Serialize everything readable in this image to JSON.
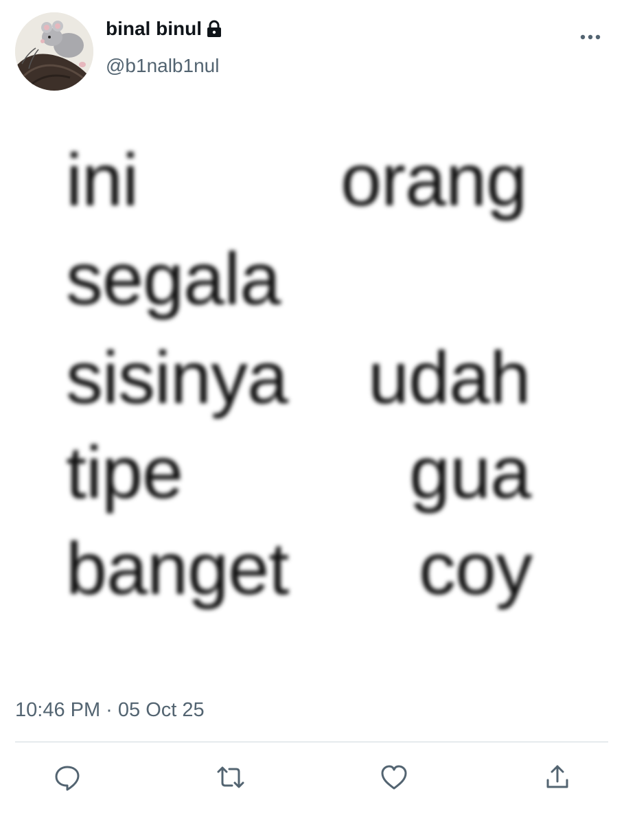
{
  "author": {
    "display_name": "binal binul",
    "handle": "@b1nalb1nul",
    "protected_icon": "lock-icon",
    "avatar_icon": "rat-avatar"
  },
  "tweet": {
    "image_words": [
      "ini",
      "orang",
      "segala",
      "sisinya",
      "udah",
      "tipe",
      "gua",
      "banget",
      "coy"
    ],
    "timestamp": "10:46 PM · 05 Oct 25"
  },
  "actions": {
    "more": "more-icon",
    "reply": "reply-icon",
    "retweet": "retweet-icon",
    "like": "heart-icon",
    "share": "share-icon"
  },
  "colors": {
    "primary_text": "#0f1419",
    "secondary_text": "#536471",
    "divider": "#cfd9de"
  }
}
